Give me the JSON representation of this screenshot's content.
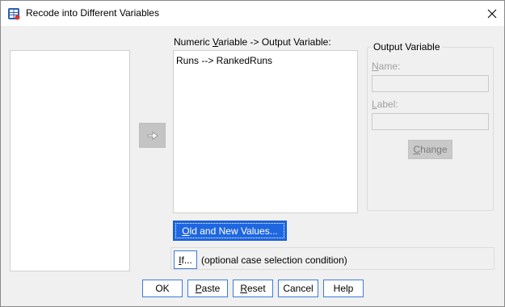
{
  "window": {
    "title": "Recode into Different Variables",
    "icons": {
      "app": "recode-table-icon",
      "close": "close-icon"
    }
  },
  "target_list": {
    "label_parts": [
      "Numeric ",
      "V",
      "ariable -> Output Variable:"
    ],
    "items": [
      "Runs --> RankedRuns"
    ]
  },
  "move_button": {
    "icon": "right-arrow-icon",
    "state": "disabled"
  },
  "output_variable": {
    "group_title": "Output Variable",
    "name_label_parts": [
      "N",
      "ame:"
    ],
    "name_value": "",
    "label_label_parts": [
      "L",
      "abel:"
    ],
    "label_value": "",
    "change_label_parts": [
      "C",
      "hange"
    ]
  },
  "old_new_button": {
    "label_parts": [
      "O",
      "ld and New Values..."
    ]
  },
  "if_section": {
    "button_parts": [
      "I",
      "f..."
    ],
    "description": "(optional case selection condition)"
  },
  "buttons": {
    "ok": {
      "label": "OK"
    },
    "paste": {
      "label_parts": [
        "P",
        "aste"
      ]
    },
    "reset": {
      "label_parts": [
        "R",
        "eset"
      ]
    },
    "cancel": {
      "label": "Cancel"
    },
    "help": {
      "label": "Help"
    }
  },
  "colors": {
    "accent": "#1f67e0",
    "dialog_background": "#f0f0f0",
    "disabled_text": "#a0a0a0"
  }
}
